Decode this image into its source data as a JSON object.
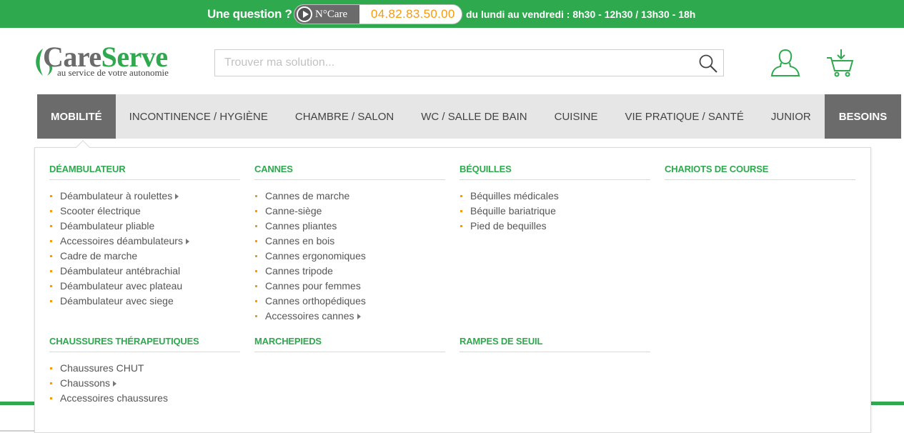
{
  "topbar": {
    "question": "Une question ?",
    "ncare_label": "N°Care",
    "phone": "04.82.83.50.00",
    "hours": "du lundi au vendredi : 8h30 - 12h30 / 13h30 - 18h",
    "bg_color": "#2ea94e",
    "phone_color": "#f39c12"
  },
  "logo": {
    "care": "Care",
    "serve": "Serve",
    "tagline": "au service de votre autonomie"
  },
  "search": {
    "placeholder": "Trouver ma solution..."
  },
  "nav": {
    "items": [
      "MOBILITÉ",
      "INCONTINENCE / HYGIÈNE",
      "CHAMBRE / SALON",
      "WC / SALLE DE BAIN",
      "CUISINE",
      "VIE PRATIQUE / SANTÉ",
      "JUNIOR"
    ],
    "besoins": "BESOINS"
  },
  "menu": {
    "columns": [
      {
        "title": "DÉAMBULATEUR",
        "items": [
          "Déambulateur à roulettes",
          "Scooter électrique",
          "Déambulateur pliable",
          "Accessoires déambulateurs",
          "Cadre de marche",
          "Déambulateur antébrachial",
          "Déambulateur avec plateau",
          "Déambulateur avec siege"
        ]
      },
      {
        "title": "CANNES",
        "items": [
          "Cannes de marche",
          "Canne-siège",
          "Cannes pliantes",
          "Cannes en bois",
          "Cannes ergonomiques",
          "Cannes tripode",
          "Cannes pour femmes",
          "Cannes orthopédiques",
          "Accessoires cannes"
        ]
      },
      {
        "title": "BÉQUILLES",
        "items": [
          "Béquilles médicales",
          "Béquille bariatrique",
          "Pied de bequilles"
        ]
      },
      {
        "title": "CHARIOTS DE COURSE",
        "items": []
      },
      {
        "title": "CHAUSSURES THÉRAPEUTIQUES",
        "items": [
          "Chaussures CHUT",
          "Chaussons",
          "Accessoires chaussures"
        ]
      },
      {
        "title": "MARCHEPIEDS",
        "items": []
      },
      {
        "title": "RAMPES DE SEUIL",
        "items": []
      }
    ]
  },
  "icons": {
    "search": "search-icon",
    "user": "user-icon",
    "cart": "cart-icon",
    "submenu": "chevron-right-icon"
  },
  "colors": {
    "accent": "#2ea94e",
    "nav_active": "#6b6b6b",
    "bullet": "#f39c12"
  }
}
